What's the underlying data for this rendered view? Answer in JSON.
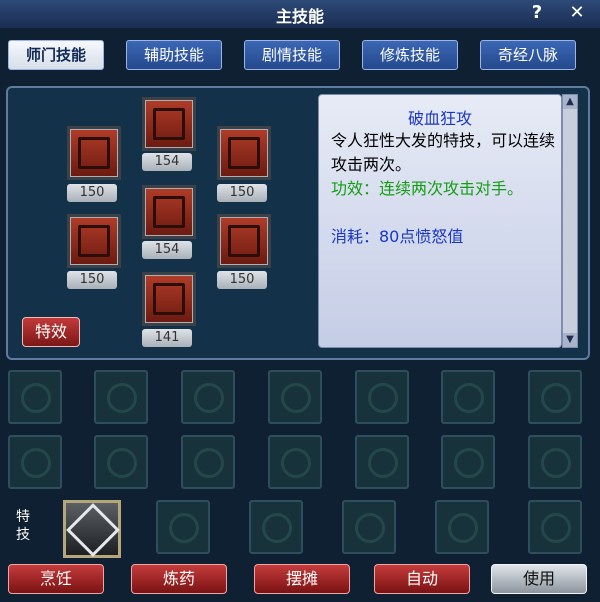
{
  "window": {
    "title": "主技能",
    "help_label": "?",
    "close_label": "✕"
  },
  "tabs": [
    {
      "label": "师门技能",
      "active": true
    },
    {
      "label": "辅助技能",
      "active": false
    },
    {
      "label": "剧情技能",
      "active": false
    },
    {
      "label": "修炼技能",
      "active": false
    },
    {
      "label": "奇经八脉",
      "active": false
    }
  ],
  "skills": {
    "items": [
      {
        "level": "154"
      },
      {
        "level": "150"
      },
      {
        "level": "150"
      },
      {
        "level": "154"
      },
      {
        "level": "150"
      },
      {
        "level": "150"
      },
      {
        "level": "141"
      }
    ]
  },
  "effects_button_label": "特效",
  "detail": {
    "title": "破血狂攻",
    "description": "令人狂性大发的特技，可以连续攻击两次。",
    "effect": "功效：连续两次攻击对手。",
    "cost": "消耗：80点愤怒值"
  },
  "special_label": "特技",
  "bottom_buttons": {
    "cook": "烹饪",
    "alchemy": "炼药",
    "stall": "摆摊",
    "auto": "自动",
    "use": "使用"
  },
  "colors": {
    "accent_blue": "#1a37c7",
    "effect_green": "#139d13",
    "button_red": "#c53b3b"
  }
}
